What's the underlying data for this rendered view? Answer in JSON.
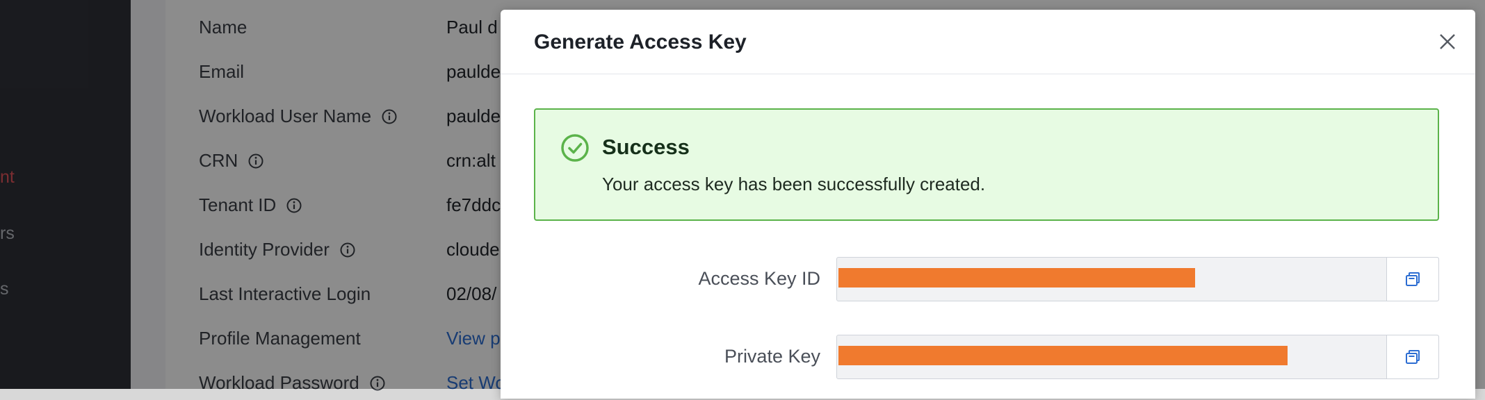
{
  "sidebar": {
    "items": [
      {
        "label": "nt",
        "active": true
      },
      {
        "label": "rs",
        "active": false
      },
      {
        "label": "s",
        "active": false
      }
    ]
  },
  "profile": {
    "rows": [
      {
        "label": "Name",
        "value": "Paul d",
        "info": false,
        "link": false
      },
      {
        "label": "Email",
        "value": "paulde",
        "info": false,
        "link": false
      },
      {
        "label": "Workload User Name",
        "value": "paulde",
        "info": true,
        "link": false
      },
      {
        "label": "CRN",
        "value": "crn:alt",
        "info": true,
        "link": false
      },
      {
        "label": "Tenant ID",
        "value": "fe7ddc",
        "info": true,
        "link": false
      },
      {
        "label": "Identity Provider",
        "value": "cloude",
        "info": true,
        "link": false
      },
      {
        "label": "Last Interactive Login",
        "value": "02/08/",
        "info": false,
        "link": false
      },
      {
        "label": "Profile Management",
        "value": "View p",
        "info": false,
        "link": true
      },
      {
        "label": "Workload Password",
        "value": "Set Wo",
        "info": true,
        "link": true
      }
    ]
  },
  "modal": {
    "title": "Generate Access Key",
    "close_icon": "close-icon",
    "alert": {
      "title": "Success",
      "message": "Your access key has been successfully created.",
      "icon": "check-circle-icon",
      "color": "#5bb34a"
    },
    "fields": [
      {
        "label": "Access Key ID",
        "redacted_fraction": 0.52,
        "copy_icon": "copy-icon"
      },
      {
        "label": "Private Key",
        "redacted_fraction": 0.655,
        "copy_icon": "copy-icon"
      }
    ]
  },
  "colors": {
    "accent_link": "#2c6dd2",
    "active_nav": "#e0535a",
    "redaction": "#f07a2e"
  }
}
